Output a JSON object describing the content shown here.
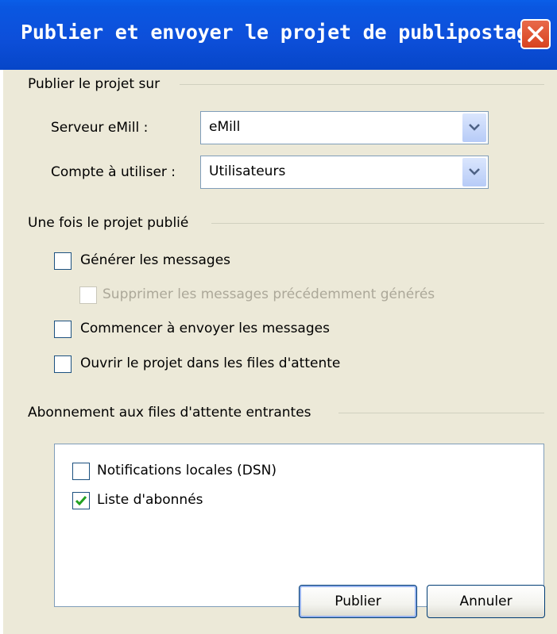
{
  "window": {
    "title": "Publier et envoyer le projet de publipostage"
  },
  "publish_group": {
    "label": "Publier le projet sur",
    "server_label": "Serveur eMill :",
    "server_value": "eMill",
    "account_label": "Compte à utiliser :",
    "account_value": "Utilisateurs"
  },
  "after_group": {
    "label": "Une fois le projet publié",
    "options": [
      {
        "label": "Générer les messages",
        "checked": false,
        "enabled": true
      },
      {
        "label": "Supprimer les messages précédemment générés",
        "checked": false,
        "enabled": false
      },
      {
        "label": "Commencer à envoyer les messages",
        "checked": false,
        "enabled": true
      },
      {
        "label": "Ouvrir le projet dans les files d'attente",
        "checked": false,
        "enabled": true
      }
    ]
  },
  "subscription_group": {
    "label": "Abonnement aux files d'attente entrantes",
    "items": [
      {
        "label": "Notifications locales (DSN)",
        "checked": false
      },
      {
        "label": "Liste d'abonnés",
        "checked": true
      }
    ]
  },
  "buttons": {
    "publish": "Publier",
    "cancel": "Annuler"
  },
  "colors": {
    "titlebar": "#0a57e1",
    "dialog_bg": "#ece9d8",
    "checkmark": "#21a121"
  }
}
